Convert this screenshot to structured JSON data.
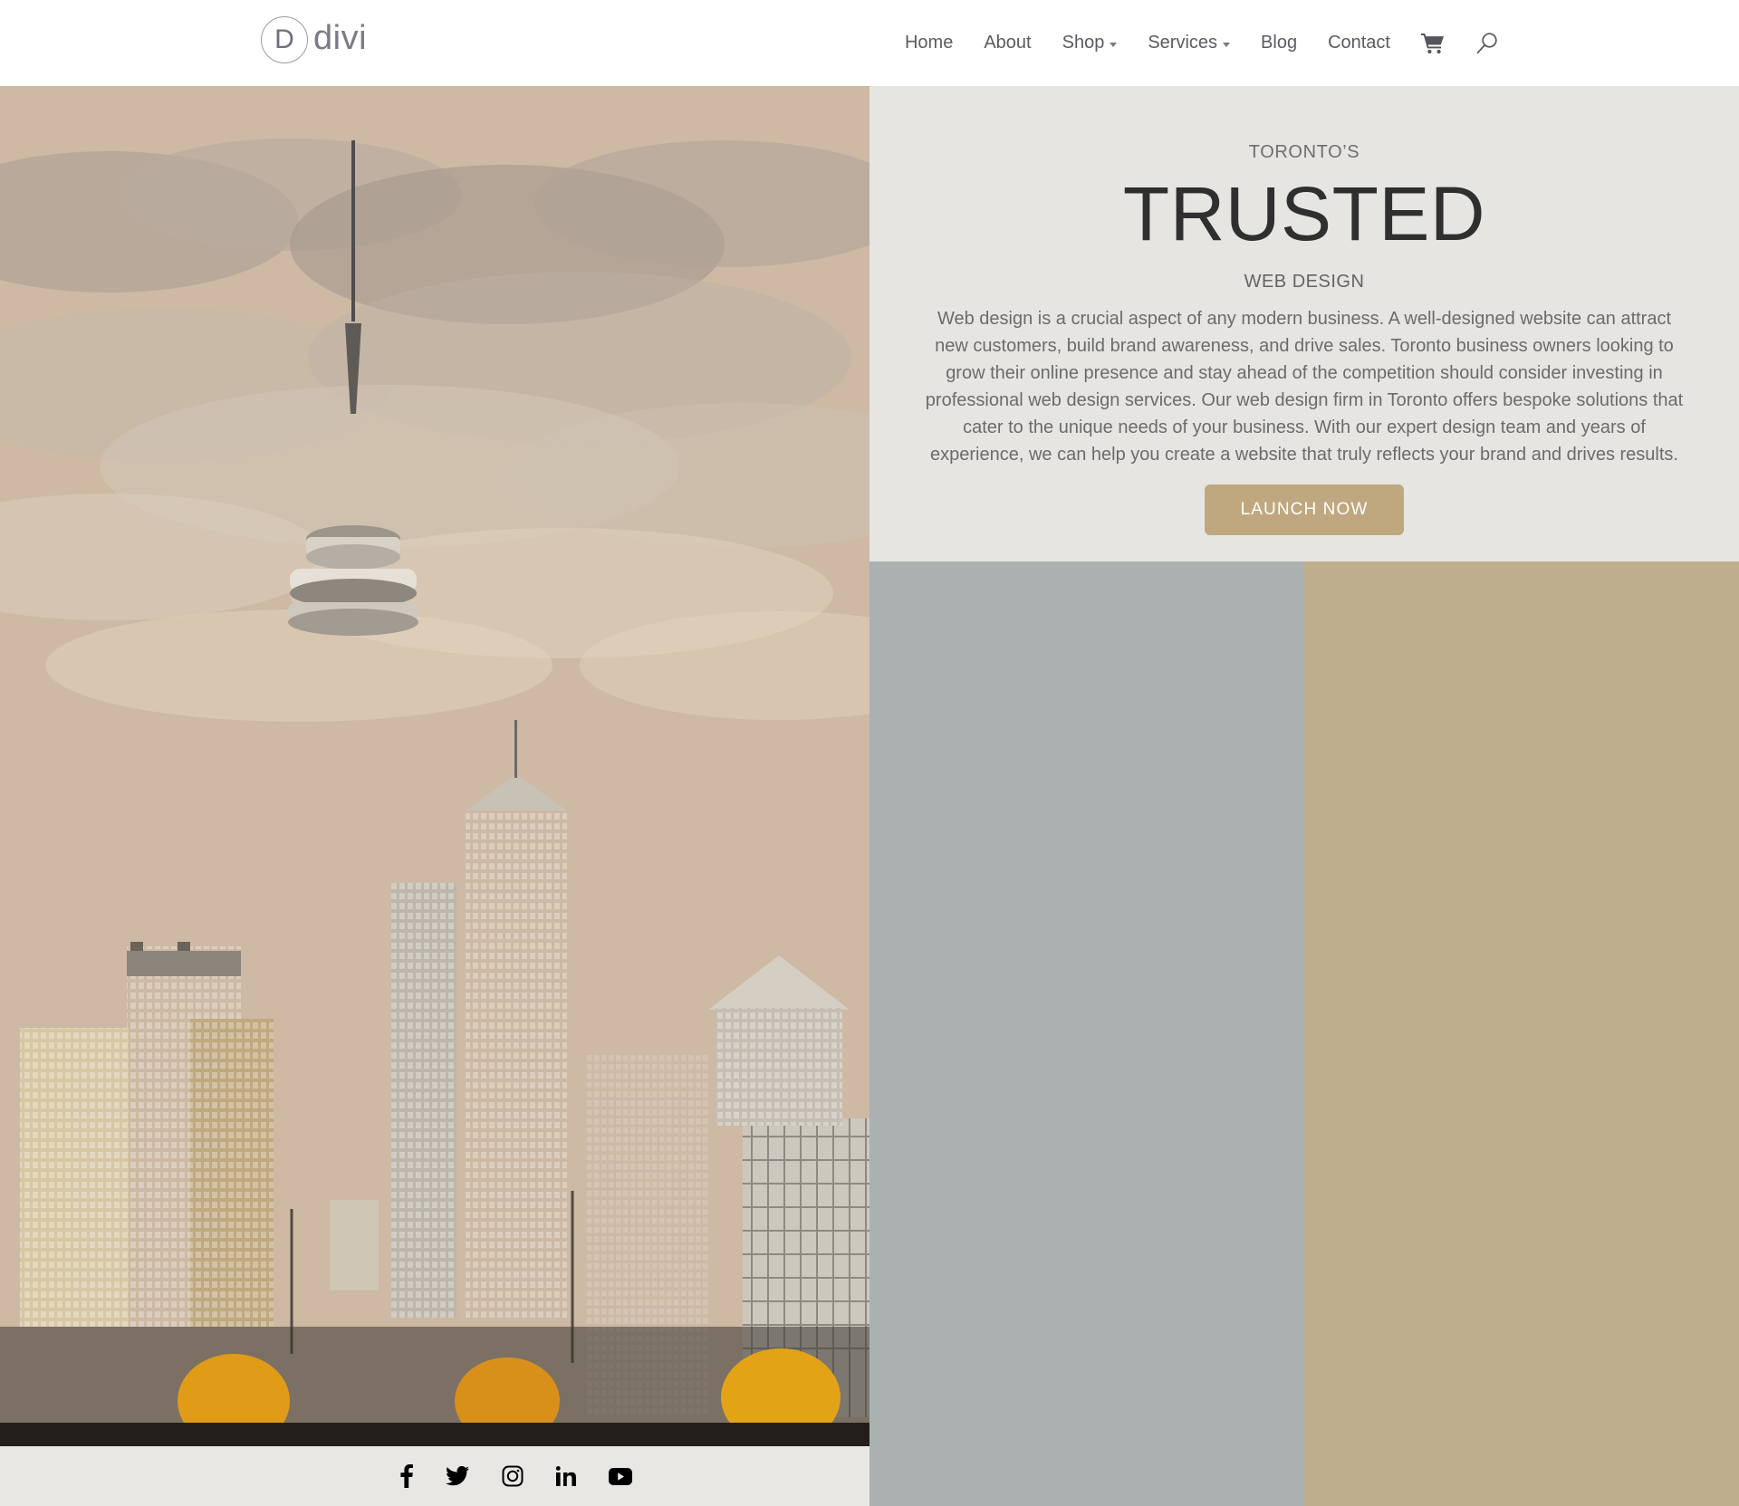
{
  "header": {
    "logo": {
      "mark": "D",
      "word": "divi"
    },
    "nav_items": [
      {
        "label": "Home",
        "has_caret": false
      },
      {
        "label": "About",
        "has_caret": false
      },
      {
        "label": "Shop",
        "has_caret": true
      },
      {
        "label": "Services",
        "has_caret": true
      },
      {
        "label": "Blog",
        "has_caret": false
      },
      {
        "label": "Contact",
        "has_caret": false
      }
    ],
    "icons": [
      {
        "name": "cart-icon"
      },
      {
        "name": "search-icon"
      }
    ]
  },
  "hero": {
    "eyebrow": "TORONTO’S",
    "headline": "TRUSTED",
    "subhead": "WEB DESIGN",
    "body": "Web design is a crucial aspect of any modern business. A well-designed website can attract new customers, build brand awareness, and drive sales. Toronto business owners looking to grow their online presence and stay ahead of the competition should consider investing in professional web design services. Our web design firm in Toronto offers bespoke solutions that cater to the unique needs of your business. With our expert design team and years of experience, we can help you create a website that truly reflects your brand and drives results.",
    "cta_label": "LAUNCH NOW",
    "background_color": "#e7e5e2",
    "cta_color": "#bfa87f"
  },
  "hero_image": {
    "alt": "Toronto CN Tower skyline with autumn trees"
  },
  "social": {
    "items": [
      {
        "name": "facebook-icon",
        "label": "Facebook"
      },
      {
        "name": "twitter-icon",
        "label": "Twitter"
      },
      {
        "name": "instagram-icon",
        "label": "Instagram"
      },
      {
        "name": "linkedin-icon",
        "label": "LinkedIn"
      },
      {
        "name": "youtube-icon",
        "label": "YouTube"
      }
    ],
    "background_color": "#e9e7e4"
  },
  "blocks": {
    "gray_color": "#abb1b1",
    "tan_color": "#bfae8d"
  }
}
